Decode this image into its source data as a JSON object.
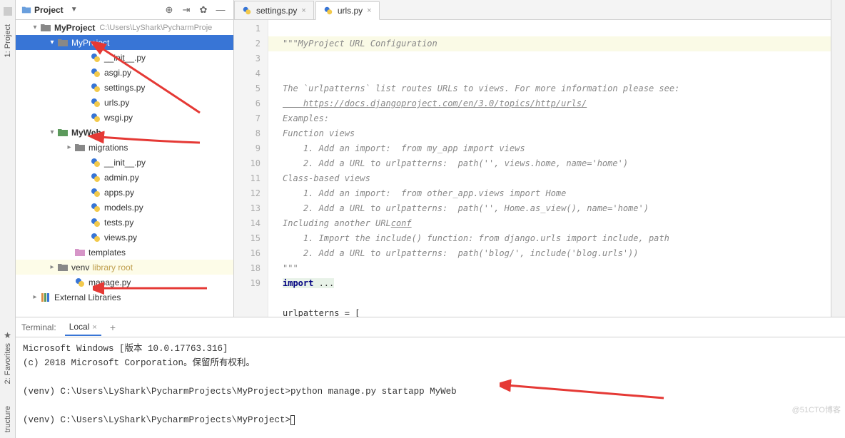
{
  "panel": {
    "title": "Project"
  },
  "root": {
    "name": "MyProject",
    "path": "C:\\Users\\LyShark\\PycharmProje"
  },
  "tree": {
    "myproject": "MyProject",
    "init": "__init__.py",
    "asgi": "asgi.py",
    "settings": "settings.py",
    "urls": "urls.py",
    "wsgi": "wsgi.py",
    "myweb": "MyWeb",
    "migrations": "migrations",
    "init2": "__init__.py",
    "admin": "admin.py",
    "apps": "apps.py",
    "models": "models.py",
    "tests": "tests.py",
    "views": "views.py",
    "templates": "templates",
    "venv": "venv",
    "venv_lib": "library root",
    "manage": "manage.py",
    "ext": "External Libraries"
  },
  "tabs": {
    "t1": "settings.py",
    "t2": "urls.py"
  },
  "code": {
    "l1": "\"\"\"MyProject URL Configuration",
    "l3": "The `urlpatterns` list routes URLs to views. For more information please see:",
    "l4": "    https://docs.djangoproject.com/en/3.0/topics/http/urls/",
    "l5": "Examples:",
    "l6": "Function views",
    "l7": "    1. Add an import:  from my_app import views",
    "l8": "    2. Add a URL to urlpatterns:  path('', views.home, name='home')",
    "l9": "Class-based views",
    "l10": "    1. Add an import:  from other_app.views import Home",
    "l11": "    2. Add a URL to urlpatterns:  path('', Home.as_view(), name='home')",
    "l12a": "Including another URL",
    "l12b": "conf",
    "l13": "    1. Import the include() function: from django.urls import include, path",
    "l14": "    2. Add a URL to urlpatterns:  path('blog/', include('blog.urls'))",
    "l15": "\"\"\"",
    "l16a": "import",
    "l16b": " ...",
    "l19": "urlpatterns = ["
  },
  "lineNumbers": [
    "1",
    "2",
    "3",
    "4",
    "5",
    "6",
    "7",
    "8",
    "9",
    "10",
    "11",
    "12",
    "13",
    "14",
    "15",
    "16",
    "18",
    "19"
  ],
  "terminal": {
    "label": "Terminal:",
    "tab": "Local",
    "l1": "Microsoft Windows [版本 10.0.17763.316]",
    "l2": "(c) 2018 Microsoft Corporation。保留所有权利。",
    "l3": "(venv) C:\\Users\\LyShark\\PycharmProjects\\MyProject>python manage.py startapp MyWeb",
    "l4": "(venv) C:\\Users\\LyShark\\PycharmProjects\\MyProject>"
  },
  "watermark": "@51CTO博客"
}
